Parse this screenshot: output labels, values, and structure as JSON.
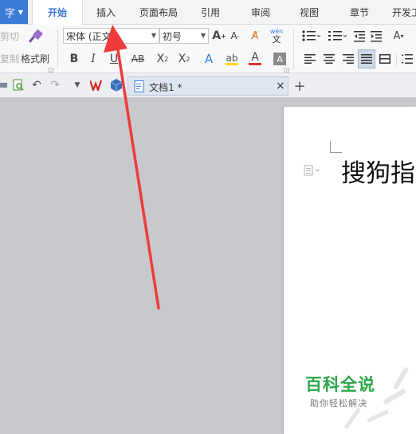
{
  "app_button": {
    "label": "字"
  },
  "menu_tabs": [
    {
      "label": "开始",
      "active": true
    },
    {
      "label": "插入"
    },
    {
      "label": "页面布局"
    },
    {
      "label": "引用"
    },
    {
      "label": "审阅"
    },
    {
      "label": "视图"
    },
    {
      "label": "章节"
    },
    {
      "label": "开发工"
    }
  ],
  "clipboard": {
    "cut": "剪切",
    "copy": "复制",
    "format_painter": "格式刷"
  },
  "font": {
    "name": "宋体 (正文)",
    "size": "初号"
  },
  "quick_access": {
    "doc_tab_label": "文档1 *",
    "close": "×",
    "new_tab": "+"
  },
  "document": {
    "visible_text": "搜狗指"
  },
  "watermark": {
    "title": "百科全说",
    "subtitle": "助你轻松解决"
  },
  "colors": {
    "accent": "#3a7bd5",
    "arrow": "#ef3b3b",
    "font_color": "#d32f2f",
    "highlight": "#ffd600",
    "watermark_green": "#2aa84a",
    "workspace": "#c7c9cf"
  }
}
